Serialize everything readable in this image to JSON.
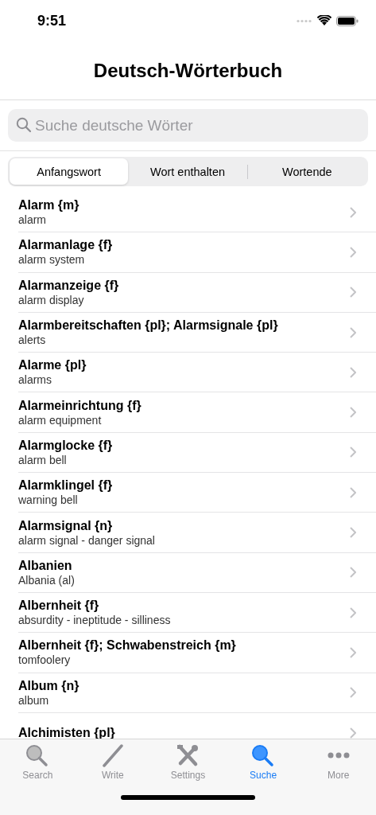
{
  "status_bar": {
    "time": "9:51"
  },
  "title": "Deutsch-Wörterbuch",
  "search": {
    "placeholder": "Suche deutsche Wörter"
  },
  "segments": [
    {
      "label": "Anfangswort",
      "selected": true
    },
    {
      "label": "Wort enthalten",
      "selected": false
    },
    {
      "label": "Wortende",
      "selected": false
    }
  ],
  "entries": [
    {
      "term": "Alarm {m}",
      "translation": "alarm"
    },
    {
      "term": "Alarmanlage {f}",
      "translation": "alarm system"
    },
    {
      "term": "Alarmanzeige {f}",
      "translation": "alarm display"
    },
    {
      "term": "Alarmbereitschaften {pl}; Alarmsignale {pl}",
      "translation": "alerts"
    },
    {
      "term": "Alarme {pl}",
      "translation": "alarms"
    },
    {
      "term": "Alarmeinrichtung {f}",
      "translation": "alarm equipment"
    },
    {
      "term": "Alarmglocke {f}",
      "translation": "alarm bell"
    },
    {
      "term": "Alarmklingel {f}",
      "translation": "warning bell"
    },
    {
      "term": "Alarmsignal {n}",
      "translation": "alarm signal - danger signal"
    },
    {
      "term": "Albanien",
      "translation": "Albania (al)"
    },
    {
      "term": "Albernheit {f}",
      "translation": "absurdity - ineptitude - silliness"
    },
    {
      "term": "Albernheit {f}; Schwabenstreich {m}",
      "translation": "tomfoolery"
    },
    {
      "term": "Album {n}",
      "translation": "album"
    },
    {
      "term": "Alchimisten {pl}"
    }
  ],
  "tab_bar": [
    {
      "label": "Search",
      "kind": "search",
      "selected": false
    },
    {
      "label": "Write",
      "kind": "write",
      "selected": false
    },
    {
      "label": "Settings",
      "kind": "settings",
      "selected": false
    },
    {
      "label": "Suche",
      "kind": "search",
      "selected": true
    },
    {
      "label": "More",
      "kind": "more",
      "selected": false
    }
  ]
}
